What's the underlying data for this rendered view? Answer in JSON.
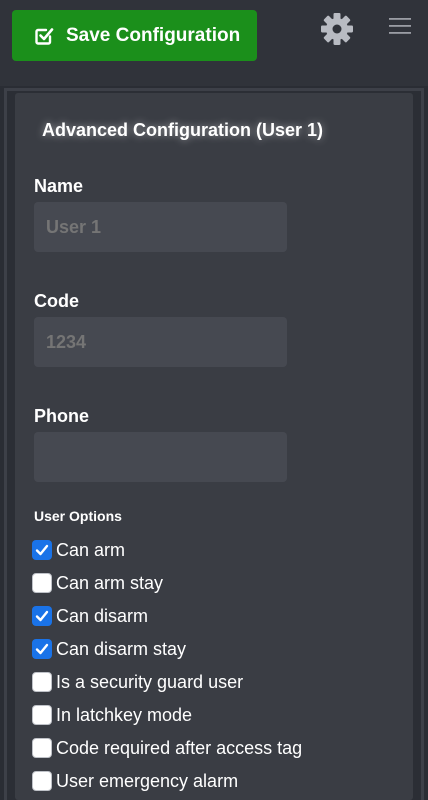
{
  "toolbar": {
    "save_label": "Save Configuration",
    "icons": [
      "check-square-icon",
      "gear-icon",
      "hamburger-menu-icon"
    ]
  },
  "panel": {
    "title": "Advanced Configuration (User 1)"
  },
  "fields": {
    "name_label": "Name",
    "name_value": "User 1",
    "code_label": "Code",
    "code_value": "1234",
    "phone_label": "Phone",
    "phone_value": ""
  },
  "options": {
    "heading": "User Options",
    "items": [
      {
        "label": "Can arm",
        "checked": true
      },
      {
        "label": "Can arm stay",
        "checked": false
      },
      {
        "label": "Can disarm",
        "checked": true
      },
      {
        "label": "Can disarm stay",
        "checked": true
      },
      {
        "label": "Is a security guard user",
        "checked": false
      },
      {
        "label": "In latchkey mode",
        "checked": false
      },
      {
        "label": "Code required after access tag",
        "checked": false
      },
      {
        "label": "User emergency alarm",
        "checked": false
      }
    ]
  },
  "colors": {
    "save_button": "#1b8f1b",
    "checkbox_on": "#1a73e8",
    "background": "#2a2d34"
  }
}
